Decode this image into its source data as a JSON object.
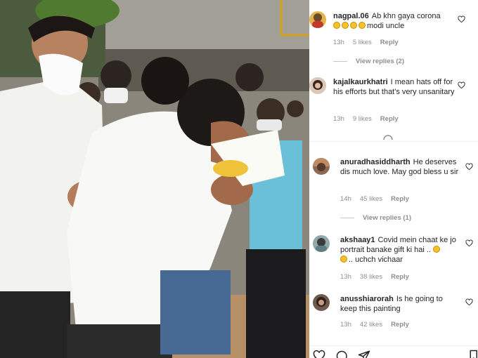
{
  "comments": [
    {
      "username": "nagpal.06",
      "text": "Ab khn gaya corona",
      "text_continued": "modi uncle",
      "emoji_count": 4,
      "time": "13h",
      "likes": "5 likes",
      "reply_label": "Reply",
      "view_replies": "View replies (2)"
    },
    {
      "username": "kajalkaurkhatri",
      "text": "I mean hats off for his efforts but that's very unsanitary",
      "time": "13h",
      "likes": "9 likes",
      "reply_label": "Reply"
    },
    {
      "username": "anuradhasiddharth",
      "text": "He deserves dis much love. May god bless u sir",
      "time": "14h",
      "likes": "45 likes",
      "reply_label": "Reply",
      "view_replies": "View replies (1)"
    },
    {
      "username": "akshaay1",
      "text": "Covid mein chaat ke jo portrait banake gift ki hai ..",
      "text_continued": ".. uchch vichaar",
      "time": "13h",
      "likes": "38 likes",
      "reply_label": "Reply"
    },
    {
      "username": "anusshiarorah",
      "text": "Is he going to keep this painting",
      "time": "13h",
      "likes": "42 likes",
      "reply_label": "Reply"
    }
  ],
  "icons": {
    "like": "heart-icon",
    "comment": "comment-icon",
    "share": "share-icon",
    "loading": "spinner-icon"
  },
  "colors": {
    "text": "#262626",
    "meta": "#8e8e8e",
    "emoji": "#f5c22c"
  }
}
